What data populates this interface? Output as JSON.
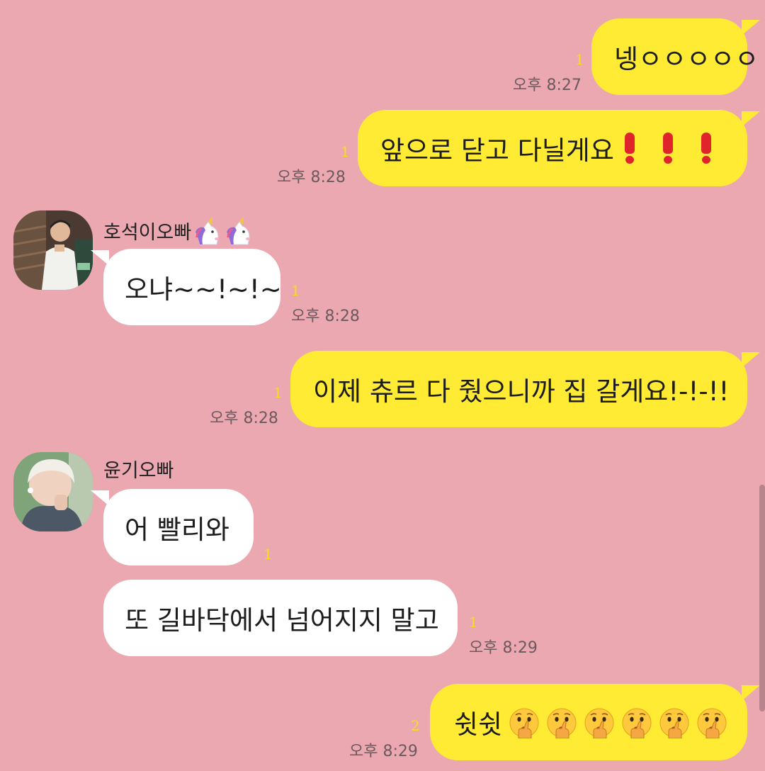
{
  "messages": [
    {
      "id": "m1",
      "from": "me",
      "text": "넹ㅇㅇㅇㅇㅇ",
      "unread": "1",
      "time": "오후 8:27"
    },
    {
      "id": "m2",
      "from": "me",
      "text": "앞으로 닫고 다닐게요",
      "unread": "1",
      "time": "오후 8:28",
      "emoji": "exclamation-marks"
    },
    {
      "id": "m3",
      "from": "호석이오빠",
      "text": "오냐~~!~!~",
      "unread": "1",
      "time": "오후 8:28"
    },
    {
      "id": "m4",
      "from": "me",
      "text": "이제 츄르 다 줬으니까 집 갈게요!-!-!!",
      "unread": "1",
      "time": "오후 8:28"
    },
    {
      "id": "m5",
      "from": "윤기오빠",
      "text": "어 빨리와",
      "unread": "1"
    },
    {
      "id": "m6",
      "from": "윤기오빠",
      "text": "또 길바닥에서 넘어지지 말고",
      "unread": "1",
      "time": "오후 8:29"
    },
    {
      "id": "m7",
      "from": "me",
      "text": "쉿쉿",
      "unread": "2",
      "time": "오후 8:29",
      "emoji": "shushing-face"
    }
  ],
  "senders": {
    "hoseok": {
      "name": "호석이오빠",
      "name_icon": "unicorn-icon"
    },
    "yoongi": {
      "name": "윤기오빠"
    }
  },
  "colors": {
    "background": "#EBA8B1",
    "my_bubble": "#FFEB33",
    "their_bubble": "#FFFFFF",
    "unread_count": "#F5DC23",
    "exclamation": "#E0242C"
  }
}
